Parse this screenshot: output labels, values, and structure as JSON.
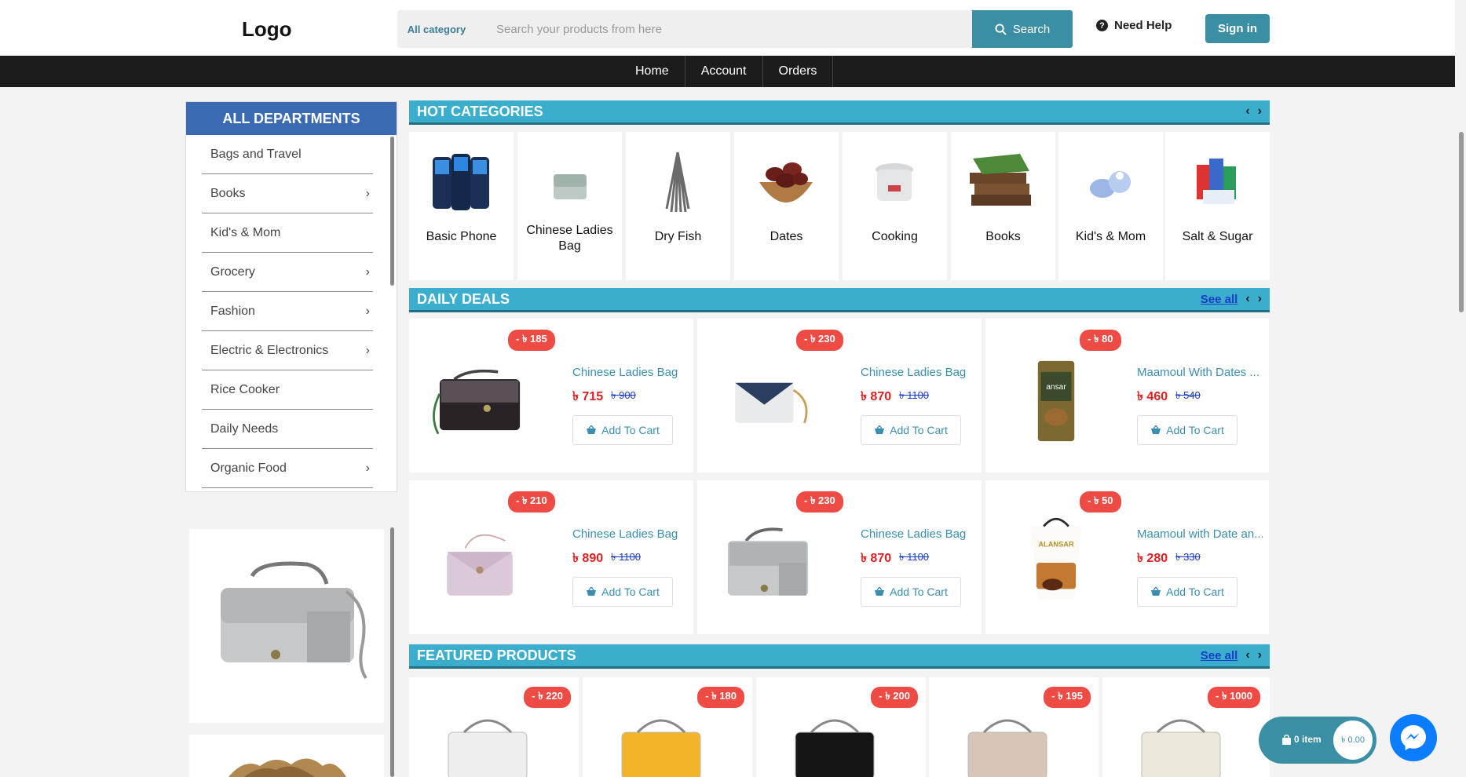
{
  "header": {
    "logo": "Logo",
    "category_label": "All category",
    "search_placeholder": "Search your products from here",
    "search_button": "Search",
    "help": "Need Help",
    "signin": "Sign in"
  },
  "nav": [
    "Home",
    "Account",
    "Orders"
  ],
  "departments": {
    "title": "ALL DEPARTMENTS",
    "items": [
      {
        "label": "Bags and Travel",
        "has_sub": false
      },
      {
        "label": "Books",
        "has_sub": true
      },
      {
        "label": "Kid's & Mom",
        "has_sub": false
      },
      {
        "label": "Grocery",
        "has_sub": true
      },
      {
        "label": "Fashion",
        "has_sub": true
      },
      {
        "label": "Electric & Electronics",
        "has_sub": true
      },
      {
        "label": "Rice Cooker",
        "has_sub": false
      },
      {
        "label": "Daily Needs",
        "has_sub": false
      },
      {
        "label": "Organic Food",
        "has_sub": true
      }
    ]
  },
  "hot_categories": {
    "title": "HOT CATEGORIES",
    "items": [
      "Basic Phone",
      "Chinese Ladies Bag",
      "Dry Fish",
      "Dates",
      "Cooking",
      "Books",
      "Kid's & Mom",
      "Salt & Sugar"
    ]
  },
  "daily_deals": {
    "title": "DAILY DEALS",
    "see_all": "See all",
    "cart_label": "Add To Cart",
    "items": [
      {
        "discount": "- ৳ 185",
        "name": "Chinese Ladies Bag",
        "price": "৳ 715",
        "old": "৳ 900"
      },
      {
        "discount": "- ৳ 230",
        "name": "Chinese Ladies Bag",
        "price": "৳ 870",
        "old": "৳ 1100"
      },
      {
        "discount": "- ৳ 80",
        "name": "Maamoul With Dates ...",
        "price": "৳ 460",
        "old": "৳ 540"
      },
      {
        "discount": "- ৳ 210",
        "name": "Chinese Ladies Bag",
        "price": "৳ 890",
        "old": "৳ 1100"
      },
      {
        "discount": "- ৳ 230",
        "name": "Chinese Ladies Bag",
        "price": "৳ 870",
        "old": "৳ 1100"
      },
      {
        "discount": "- ৳ 50",
        "name": "Maamoul with Date an...",
        "price": "৳ 280",
        "old": "৳ 330"
      }
    ]
  },
  "featured": {
    "title": "FEATURED PRODUCTS",
    "see_all": "See all",
    "discounts": [
      "- ৳ 220",
      "- ৳ 180",
      "- ৳ 200",
      "- ৳ 195",
      "- ৳ 1000"
    ]
  },
  "cart": {
    "count": "0 item",
    "total": "৳ 0.00"
  },
  "colors": {
    "accent": "#3b8fa4",
    "section": "#3aaecc",
    "dept": "#3a6ab2",
    "badge": "#ef4b45"
  }
}
